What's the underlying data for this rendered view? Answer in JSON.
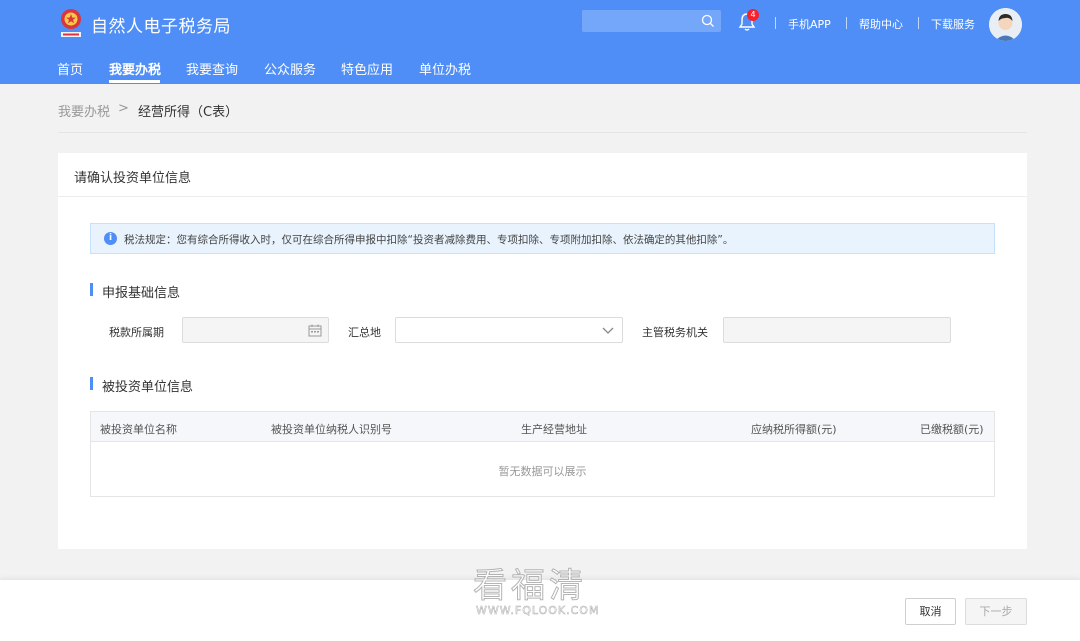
{
  "header": {
    "site_title": "自然人电子税务局",
    "logo_icon": "tax-emblem-icon",
    "notification_count": "4",
    "links": [
      "手机APP",
      "帮助中心",
      "下载服务"
    ]
  },
  "nav": {
    "items": [
      "首页",
      "我要办税",
      "我要查询",
      "公众服务",
      "特色应用",
      "单位办税"
    ],
    "active": "我要办税"
  },
  "breadcrumb": {
    "root": "我要办税",
    "separator": ">",
    "current": "经营所得（C表）"
  },
  "card": {
    "title": "请确认投资单位信息",
    "notice": "税法规定：您有综合所得收入时，仅可在综合所得申报中扣除“投资者减除费用、专项扣除、专项附加扣除、依法确定的其他扣除”。",
    "basic_section": {
      "title": "申报基础信息",
      "period_label": "税款所属期",
      "period_value": "",
      "region_label": "汇总地",
      "region_value": "",
      "authority_label": "主管税务机关",
      "authority_value": ""
    },
    "invest_section": {
      "title": "被投资单位信息",
      "columns": [
        "被投资单位名称",
        "被投资单位纳税人识别号",
        "生产经营地址",
        "应纳税所得额(元)",
        "已缴税额(元)"
      ],
      "rows": [],
      "empty_text": "暂无数据可以展示"
    }
  },
  "footer": {
    "cancel_label": "取消",
    "next_label": "下一步"
  },
  "watermark": {
    "main": "看福清",
    "sub": "WWW.FQLOOK.COM"
  },
  "colors": {
    "primary": "#4f8ef7",
    "notice_bg": "#e8f3fd",
    "badge": "#f5222d"
  }
}
